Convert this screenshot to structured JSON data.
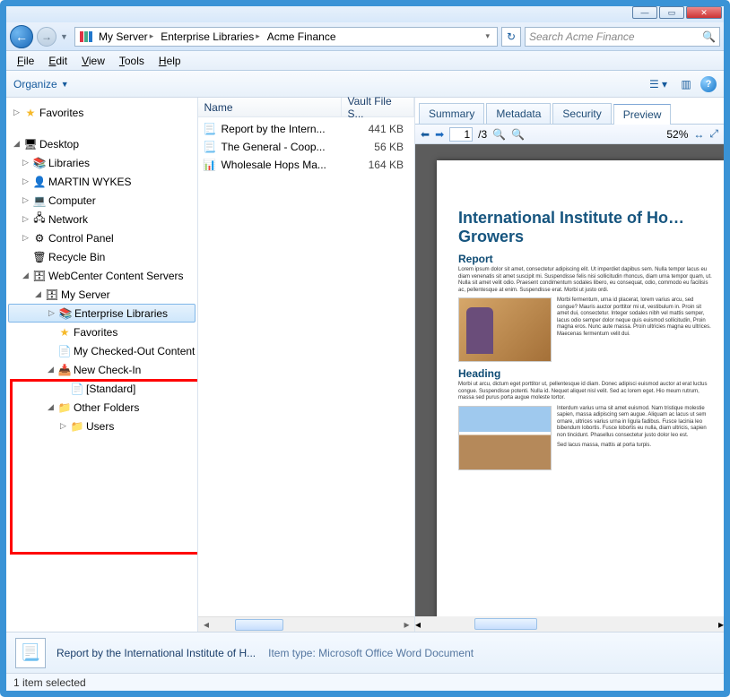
{
  "window_controls": {
    "minimize": "—",
    "maximize": "▭",
    "close": "✕"
  },
  "nav": {
    "back": "←",
    "forward": "→"
  },
  "address": {
    "crumbs": [
      "My Server",
      "Enterprise Libraries",
      "Acme Finance"
    ],
    "sep": "▸"
  },
  "search": {
    "placeholder": "Search Acme Finance"
  },
  "menu": {
    "file": "File",
    "edit": "Edit",
    "view": "View",
    "tools": "Tools",
    "help": "Help"
  },
  "cmdbar": {
    "organize": "Organize"
  },
  "tree": {
    "favorites": "Favorites",
    "desktop": "Desktop",
    "libraries": "Libraries",
    "user": "MARTIN WYKES",
    "computer": "Computer",
    "network": "Network",
    "controlpanel": "Control Panel",
    "recyclebin": "Recycle Bin",
    "wcc": "WebCenter Content Servers",
    "myserver": "My Server",
    "entlib": "Enterprise Libraries",
    "treefav": "Favorites",
    "checkedout": "My Checked-Out Content",
    "newcheckin": "New Check-In",
    "standard": "[Standard]",
    "otherfolders": "Other Folders",
    "users": "Users"
  },
  "list": {
    "headers": {
      "name": "Name",
      "size": "Vault File S..."
    },
    "rows": [
      {
        "name": "Report by the Intern...",
        "size": "441 KB",
        "icon": "word"
      },
      {
        "name": "The General - Coop...",
        "size": "56 KB",
        "icon": "word"
      },
      {
        "name": "Wholesale Hops Ma...",
        "size": "164 KB",
        "icon": "excel"
      }
    ]
  },
  "preview": {
    "tabs": {
      "summary": "Summary",
      "metadata": "Metadata",
      "security": "Security",
      "preview": "Preview"
    },
    "page_current": "1",
    "page_total": "/3",
    "zoom": "52%",
    "doc": {
      "title": "International Institute of Ho… Growers",
      "h1": "Report",
      "p1": "Lorem ipsum dolor sit amet, consectetur adipiscing elit. Ut imperdiet dapibus sem. Nulla tempor lacus eu diam venenatis sit amet suscipit mi. Suspendisse felis nisi sollicitudin rhoncus, diam urna tempor quam, ut. Nulla sit amet velit odio. Praesent condimentum sodales libero, eu consequat, odio, commodo eu facilisis ac, pellentesque at enim. Suspendisse erat. Morbi ut justo ordi.",
      "p2": "Morbi fermentum, urna id placerat, lorem varius arcu, sed congue? Mauris auctor porttitor mi ut, vestibulum in. Proin sit amet dui, consectetur. Integer sodales nibh vel mattis semper, lacus odio semper dolor neque quis euismod sollicitudin, Proin magna eros. Nunc aute massa. Proin ultricies magna eu ultrices. Maecenas fermentum velit dui.",
      "h2": "Heading",
      "p3": "Morbi ut arcu, dictum eget porttitor ut, pellentesque id diam. Donec adipisci euismod auctor at erat luctus congue. Suspendisse potenti. Nulla id. Nequet aliquet nisl velit. Sed ac lorem eget. Hio meum rutrum, massa sed purus porta augue moleste tortor.",
      "p4": "Interdum varius urna sit amet euismod. Nam tristique molestie sapien, massa adipiscing sem augue. Aliquam ac lacus ut sem ornare, ultrices varius urna in ligula fadibus. Fusce lacinia leo bibendum lobortis. Fusce lobortis eu nulla, diam ultricis, sapien non tincidunt. Phasellus consectetur justo dolor leo est.",
      "p5": "Sed lacus massa, mattis at porta turpis."
    }
  },
  "details": {
    "title": "Report by the International Institute of H...",
    "type_label": "Item type:",
    "type_value": "Microsoft Office Word Document"
  },
  "status": {
    "text": "1 item selected"
  }
}
